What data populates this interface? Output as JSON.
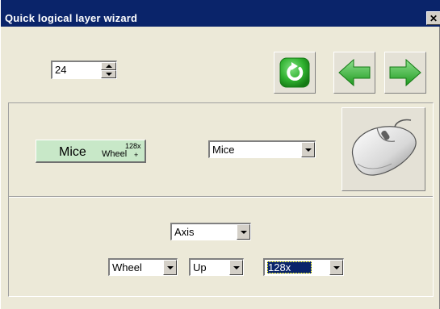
{
  "window": {
    "title": "Quick logical layer wizard",
    "close_glyph": "✕"
  },
  "toolbar": {
    "layer_number": "24",
    "refresh_icon": "refresh-icon",
    "back_icon": "arrow-left-icon",
    "forward_icon": "arrow-right-icon",
    "accent_color": "#2fb12f"
  },
  "mapping_label": {
    "main": "Mice",
    "sub": "Wheel",
    "superscript": "128x",
    "plus": "+"
  },
  "device_select": {
    "value": "Mice"
  },
  "device_icon": "mouse-icon",
  "control_type_select": {
    "value": "Axis"
  },
  "axis_select": {
    "value": "Wheel"
  },
  "direction_select": {
    "value": "Up"
  },
  "multiplier_select": {
    "value": "128x"
  }
}
